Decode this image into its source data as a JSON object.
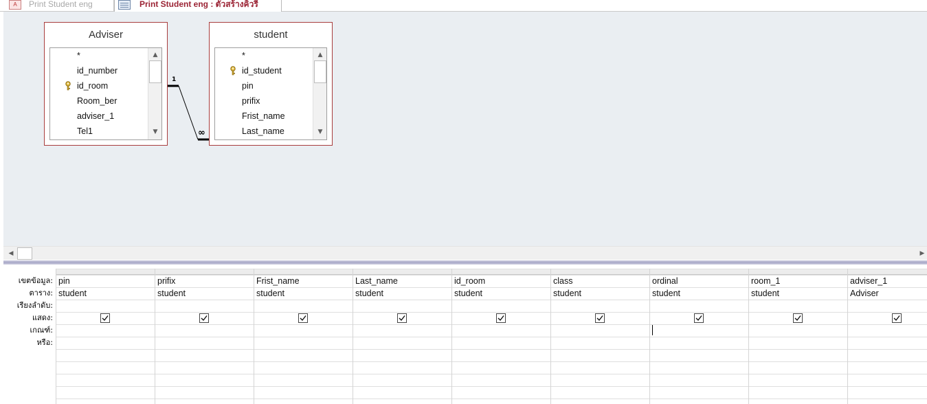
{
  "tabs": [
    {
      "label": "Print Student eng",
      "icon": "report-icon",
      "active": false
    },
    {
      "label": "Print Student eng : ตัวสร้างคิวรี",
      "icon": "query-icon",
      "active": true
    }
  ],
  "tables": {
    "adviser": {
      "title": "Adviser",
      "fields": [
        "*",
        "id_number",
        "id_room",
        "Room_ber",
        "adviser_1",
        "Tel1"
      ],
      "key_field": "id_room"
    },
    "student": {
      "title": "student",
      "fields": [
        "*",
        "id_student",
        "pin",
        "prifix",
        "Frist_name",
        "Last_name"
      ],
      "key_field": "id_student"
    }
  },
  "relationship": {
    "one_label": "1",
    "many_label": "∞"
  },
  "grid": {
    "row_labels": {
      "field": "เขตข้อมูล:",
      "table": "ตาราง:",
      "sort": "เรียงลำดับ:",
      "show": "แสดง:",
      "criteria": "เกณฑ์:",
      "or": "หรือ:"
    },
    "columns": [
      {
        "field": "pin",
        "table": "student",
        "show": true
      },
      {
        "field": "prifix",
        "table": "student",
        "show": true
      },
      {
        "field": "Frist_name",
        "table": "student",
        "show": true
      },
      {
        "field": "Last_name",
        "table": "student",
        "show": true
      },
      {
        "field": "id_room",
        "table": "student",
        "show": true
      },
      {
        "field": "class",
        "table": "student",
        "show": true
      },
      {
        "field": "ordinal",
        "table": "student",
        "show": true
      },
      {
        "field": "room_1",
        "table": "student",
        "show": true
      },
      {
        "field": "adviser_1",
        "table": "Adviser",
        "show": true
      }
    ]
  },
  "colors": {
    "accent": "#9b2334",
    "design_bg": "#eaeef2",
    "table_border": "#a83c3c"
  }
}
